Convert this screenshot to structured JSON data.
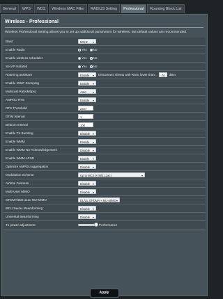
{
  "tabs": [
    {
      "label": "General",
      "active": false
    },
    {
      "label": "WPS",
      "active": false
    },
    {
      "label": "WDS",
      "active": false
    },
    {
      "label": "Wireless MAC Filter",
      "active": false
    },
    {
      "label": "RADIUS Setting",
      "active": false
    },
    {
      "label": "Professional",
      "active": true
    },
    {
      "label": "Roaming Block List",
      "active": false
    }
  ],
  "title": "Wireless - Professional",
  "description": "Wireless Professional Setting allows you to set up additional parameters for wireless. But default values are recommended.",
  "rows": [
    {
      "label": "Band",
      "type": "select",
      "value": "5GHz",
      "width": 26
    },
    {
      "label": "Enable Radio",
      "type": "radio",
      "options": [
        "Yes",
        "No"
      ],
      "selected": 0
    },
    {
      "label": "Enable wireless scheduler",
      "type": "radio",
      "options": [
        "Yes",
        "No"
      ],
      "selected": 1
    },
    {
      "label": "Set AP Isolated",
      "type": "radio",
      "options": [
        "Yes",
        "No"
      ],
      "selected": 1
    },
    {
      "label": "Roaming assistant",
      "type": "roaming",
      "value": "Enable",
      "text": "Disconnect clients with RSSI lower than :",
      "rssi": "-70",
      "unit": "dBm"
    },
    {
      "label": "Enable IGMP Snooping",
      "type": "select",
      "value": "Enable",
      "width": 26
    },
    {
      "label": "Multicast Rate(Mbps)",
      "type": "select",
      "value": "Auto",
      "width": 26
    },
    {
      "label": "AMPDU RTS",
      "type": "select",
      "value": "Enable",
      "width": 26
    },
    {
      "label": "RTS Threshold",
      "type": "input",
      "value": "2347",
      "width": 22
    },
    {
      "label": "DTIM Interval",
      "type": "input",
      "value": "1",
      "width": 22
    },
    {
      "label": "Beacon Interval",
      "type": "input",
      "value": "100",
      "width": 22
    },
    {
      "label": "Enable TX Bursting",
      "type": "select",
      "value": "Disable",
      "width": 26
    },
    {
      "label": "Enable WMM",
      "type": "select",
      "value": "Enable",
      "width": 26
    },
    {
      "label": "Enable WMM No-Acknowledgement",
      "type": "select",
      "value": "Disable",
      "width": 26
    },
    {
      "label": "Enable WMM APSD",
      "type": "select",
      "value": "Enable",
      "width": 26
    },
    {
      "label": "Optimize AMPDU aggregation",
      "type": "select",
      "value": "Disable",
      "width": 26
    },
    {
      "label": "Modulation Scheme",
      "type": "select",
      "value": "Up to MCS 9 (802.11ac)",
      "width": 96
    },
    {
      "label": "Airtime Fairness",
      "type": "select",
      "value": "Disable",
      "width": 26
    },
    {
      "label": "Multi-User MIMO",
      "type": "select",
      "value": "Disable",
      "width": 26
    },
    {
      "label": "OFDMA/802.11ax MU-MIMO",
      "type": "select",
      "value": "DL/UL OFDMA + MU-MIMO",
      "width": 60
    },
    {
      "label": "802.11ax/ac Beamforming",
      "type": "select",
      "value": "Disable",
      "width": 26
    },
    {
      "label": "Universal Beamforming",
      "type": "select",
      "value": "Disable",
      "width": 26
    },
    {
      "label": "Tx power adjustment",
      "type": "slider",
      "level": 1.0,
      "text": "Performance"
    }
  ],
  "apply_label": "Apply"
}
